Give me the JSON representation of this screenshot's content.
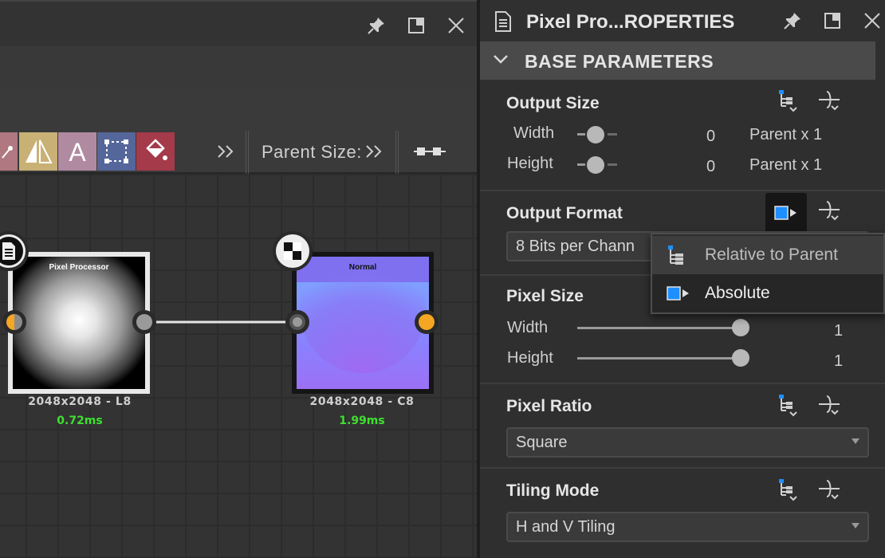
{
  "graph": {
    "toolbar": {
      "parent_size_label": "Parent Size:"
    },
    "nodes": [
      {
        "title": "Pixel Processor",
        "resolution": "2048x2048 - L8",
        "time": "0.72ms"
      },
      {
        "title": "Normal",
        "resolution": "2048x2048 - C8",
        "time": "1.99ms"
      }
    ]
  },
  "properties": {
    "title": "Pixel Pro...ROPERTIES",
    "section_title": "BASE PARAMETERS",
    "output_size": {
      "title": "Output Size",
      "width_label": "Width",
      "width_value": "0",
      "width_desc": "Parent x 1",
      "height_label": "Height",
      "height_value": "0",
      "height_desc": "Parent x 1"
    },
    "output_format": {
      "title": "Output Format",
      "selected": "8 Bits per Chann"
    },
    "mode_menu": {
      "items": [
        {
          "label": "Relative to Parent"
        },
        {
          "label": "Absolute"
        }
      ]
    },
    "pixel_size": {
      "title": "Pixel Size",
      "width_label": "Width",
      "width_value": "1",
      "height_label": "Height",
      "height_value": "1"
    },
    "pixel_ratio": {
      "title": "Pixel Ratio",
      "selected": "Square"
    },
    "tiling_mode": {
      "title": "Tiling Mode",
      "selected": "H and V Tiling"
    }
  },
  "colors": {
    "accent_blue": "#1e8fff",
    "port_orange": "#f5a623",
    "time_green": "#3de02e",
    "menu_highlight": "#3d3d3d"
  }
}
